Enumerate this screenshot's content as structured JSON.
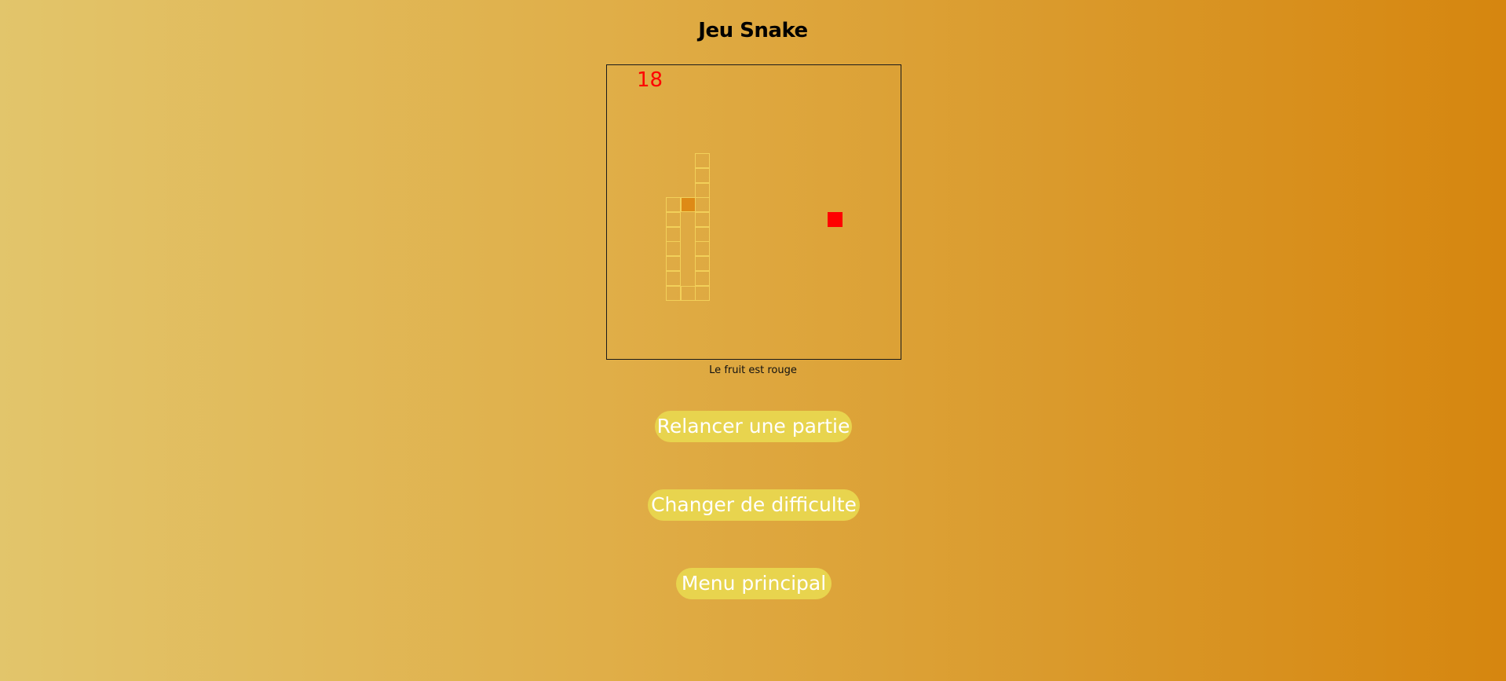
{
  "page": {
    "title": "Jeu Snake",
    "caption": "Le fruit est rouge"
  },
  "game": {
    "score": "18",
    "grid_size": 20,
    "snake_segments": [
      [
        4,
        9
      ],
      [
        4,
        10
      ],
      [
        4,
        11
      ],
      [
        4,
        12
      ],
      [
        4,
        13
      ],
      [
        4,
        14
      ],
      [
        4,
        15
      ],
      [
        5,
        15
      ],
      [
        6,
        15
      ],
      [
        6,
        14
      ],
      [
        6,
        13
      ],
      [
        6,
        12
      ],
      [
        6,
        11
      ],
      [
        6,
        10
      ],
      [
        6,
        9
      ],
      [
        6,
        8
      ],
      [
        6,
        7
      ],
      [
        6,
        6
      ],
      [
        5,
        9
      ]
    ],
    "head": [
      5,
      9
    ],
    "fruit": [
      15,
      10
    ],
    "colors": {
      "snake_outline": "#f2d05a",
      "snake_head": "#de8a16",
      "fruit": "#ff0000",
      "score": "#ff0000",
      "button_bg": "#e8d44e",
      "button_text": "#ffffff"
    }
  },
  "buttons": {
    "restart": "Relancer une partie",
    "difficulty": "Changer de difficulte",
    "menu": "Menu principal"
  }
}
